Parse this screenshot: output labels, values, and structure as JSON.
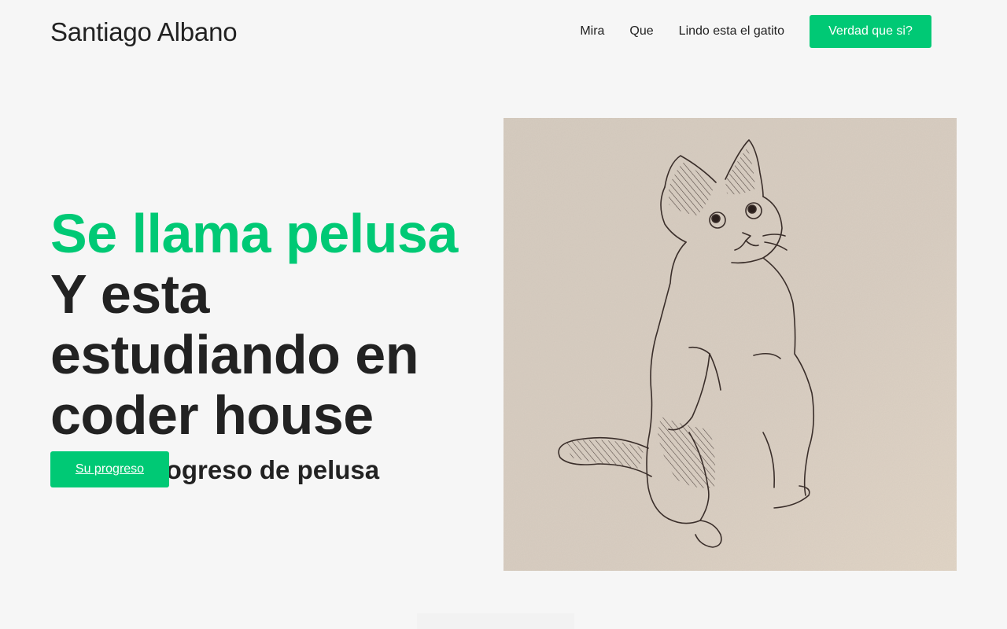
{
  "header": {
    "brand": "Santiago Albano",
    "nav": [
      {
        "label": "Mira"
      },
      {
        "label": "Que"
      },
      {
        "label": "Lindo esta el gatito"
      }
    ],
    "cta_label": "Verdad que si?"
  },
  "hero": {
    "title_highlight": "Se llama pelusa",
    "title_main": "Y esta estudiando en coder house",
    "subtitle": "Mira el progreso de pelusa",
    "button_label": "Su progreso"
  },
  "colors": {
    "accent": "#00c975",
    "text": "#222222",
    "background": "#f6f6f6"
  },
  "image": {
    "icon": "cat-sketch-illustration"
  }
}
